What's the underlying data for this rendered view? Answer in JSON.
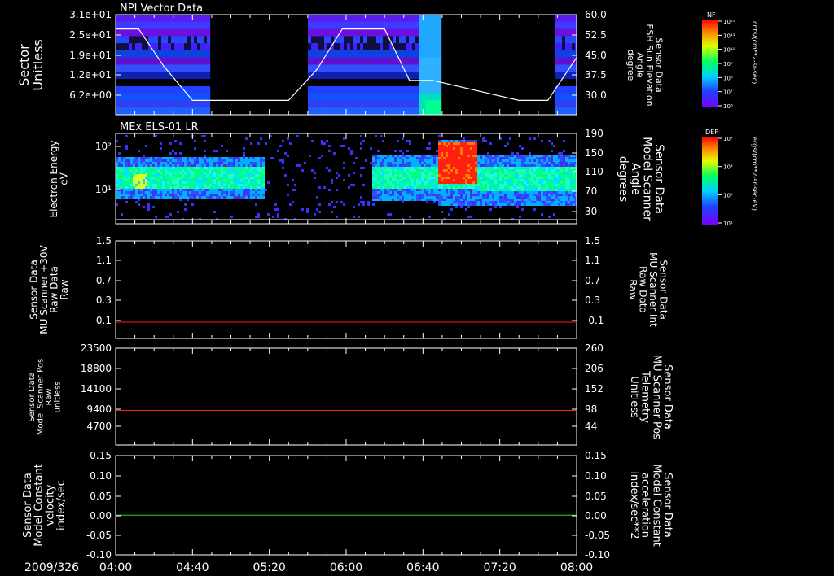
{
  "date_label": "2009/326",
  "time_ticks": [
    "04:00",
    "04:40",
    "05:20",
    "06:00",
    "06:40",
    "07:20",
    "08:00"
  ],
  "colors": {
    "frame": "#ffffff",
    "red_trace": "#ff2020",
    "green_trace": "#20e020",
    "right_red_label": "#ff2020",
    "right_green_label": "#20e020"
  },
  "chart_data": [
    {
      "type": "heatmap",
      "title": "NPI Vector Data",
      "ylabel": [
        "Sector",
        "Unitless"
      ],
      "ylim": [
        0,
        31
      ],
      "left_ticks": [
        "3.1e+01",
        "2.5e+01",
        "1.9e+01",
        "1.2e+01",
        "6.2e+00"
      ],
      "right_ylabel": [
        "Sensor Data",
        "ESH Sun Elevation",
        "Angle",
        "degree"
      ],
      "right_ylim": [
        25,
        60
      ],
      "right_ticks": [
        "60.0",
        "52.5",
        "45.0",
        "37.5",
        "30.0"
      ],
      "colorbar": {
        "title": "NF",
        "label": "cnts/(cm**2-sr-sec)",
        "ticks": [
          "10¹²",
          "10¹¹",
          "10¹⁰",
          "10⁹",
          "10⁸",
          "10⁷",
          "10⁶"
        ]
      },
      "data_gaps": [
        [
          "04:49",
          "05:40"
        ],
        [
          "06:48",
          "07:48"
        ]
      ],
      "overlay_line": {
        "name": "ESH Sun Elevation Angle",
        "x": [
          "04:00",
          "04:12",
          "04:25",
          "04:40",
          "05:30",
          "05:45",
          "05:58",
          "06:20",
          "06:33",
          "06:45",
          "07:30",
          "07:45",
          "08:00"
        ],
        "y": [
          55,
          55,
          42,
          30,
          30,
          41,
          55,
          55,
          37,
          37,
          30,
          30,
          45
        ]
      }
    },
    {
      "type": "heatmap",
      "title": "MEx ELS-01 LR",
      "ylabel": [
        "Electron Energy",
        "eV"
      ],
      "left_ticks": [
        "10²",
        "10¹"
      ],
      "scale": "log",
      "right_ylabel": [
        "Sensor Data",
        "Model Scanner",
        "Angle",
        "degrees"
      ],
      "right_ticks": [
        "190",
        "150",
        "110",
        "70",
        "30"
      ],
      "colorbar": {
        "title": "DEF",
        "label": "ergs/(cm**2-sr-sec-eV)",
        "ticks": [
          "10⁴",
          "10³",
          "10²",
          "10¹"
        ]
      },
      "intense_region": [
        "06:47",
        "07:07"
      ]
    },
    {
      "type": "line",
      "ylabel": [
        "Sensor Data",
        "MU Scanner +30V",
        "Raw Data",
        "Raw"
      ],
      "ylim": [
        -0.3,
        1.5
      ],
      "left_ticks": [
        "1.5",
        "1.1",
        "0.7",
        "0.3",
        "-0.1"
      ],
      "right_ylabel": [
        "Sensor Data",
        "MU Scanner Int",
        "Raw Data",
        "Raw"
      ],
      "right_ticks": [
        "1.5",
        "1.1",
        "0.7",
        "0.3",
        "-0.1"
      ],
      "series": [
        {
          "x": [
            "04:00",
            "08:00"
          ],
          "y": [
            0.0,
            0.0
          ]
        }
      ]
    },
    {
      "type": "line",
      "ylabel": [
        "Sensor Data",
        "Model Scanner Pos",
        "Raw",
        "unitless"
      ],
      "ylim": [
        0,
        23500
      ],
      "left_ticks": [
        "23500",
        "18800",
        "14100",
        "9400",
        "4700"
      ],
      "right_ylabel": [
        "Sensor Data",
        "MU Scanner Pos",
        "Telemetry",
        "Unitless"
      ],
      "right_ticks": [
        "260",
        "206",
        "152",
        "98",
        "44"
      ],
      "series": [
        {
          "x": [
            "04:00",
            "08:00"
          ],
          "y": [
            8400,
            8400
          ]
        }
      ]
    },
    {
      "type": "line",
      "ylabel": [
        "Sensor Data",
        "Model Constant",
        "velocity",
        "index/sec"
      ],
      "ylim": [
        -0.1,
        0.15
      ],
      "left_ticks": [
        "0.15",
        "0.10",
        "0.05",
        "0.00",
        "-0.05",
        "-0.10"
      ],
      "right_ylabel": [
        "Sensor Data",
        "Model Constant",
        "acceleration",
        "index/sec**2"
      ],
      "right_ticks": [
        "0.15",
        "0.10",
        "0.05",
        "0.00",
        "-0.05",
        "-0.10"
      ],
      "series": [
        {
          "x": [
            "04:00",
            "08:00"
          ],
          "y": [
            0.0,
            0.0
          ]
        }
      ]
    }
  ]
}
